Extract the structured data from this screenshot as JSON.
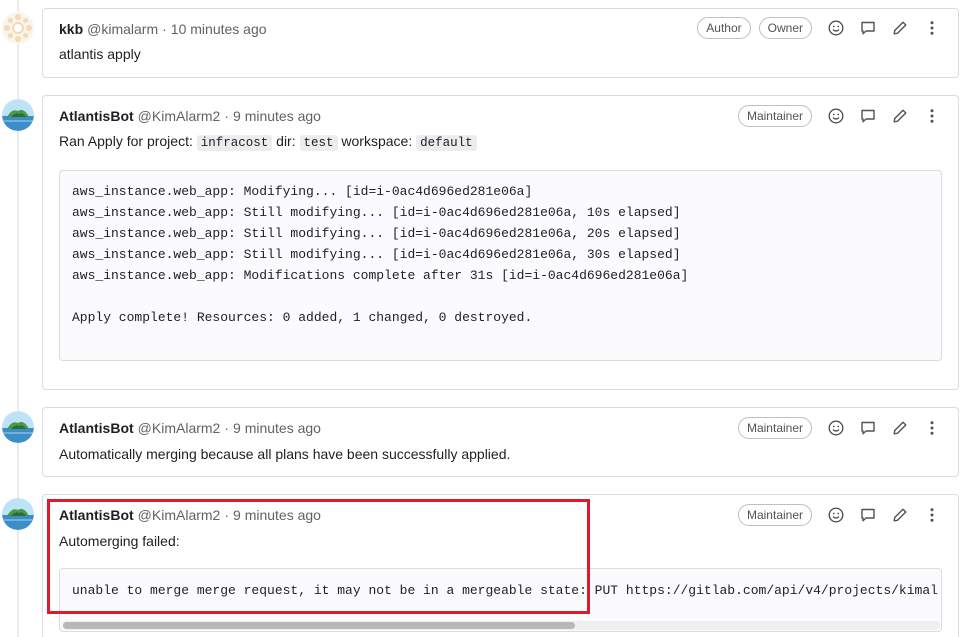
{
  "notes": [
    {
      "author": "kkb",
      "handle": "@kimalarm",
      "separator": "·",
      "time": "10 minutes ago",
      "badges": [
        "Author",
        "Owner"
      ],
      "body": "atlantis apply"
    },
    {
      "author": "AtlantisBot",
      "handle": "@KimAlarm2",
      "separator": "·",
      "time": "9 minutes ago",
      "badges": [
        "Maintainer"
      ],
      "body_parts": {
        "t1": "Ran Apply for project:",
        "c1": "infracost",
        "t2": "dir:",
        "c2": "test",
        "t3": "workspace:",
        "c3": "default"
      },
      "code_lines": [
        "aws_instance.web_app: Modifying... [id=i-0ac4d696ed281e06a]",
        "aws_instance.web_app: Still modifying... [id=i-0ac4d696ed281e06a, 10s elapsed]",
        "aws_instance.web_app: Still modifying... [id=i-0ac4d696ed281e06a, 20s elapsed]",
        "aws_instance.web_app: Still modifying... [id=i-0ac4d696ed281e06a, 30s elapsed]",
        "aws_instance.web_app: Modifications complete after 31s [id=i-0ac4d696ed281e06a]",
        "",
        "Apply complete! Resources: 0 added, 1 changed, 0 destroyed."
      ]
    },
    {
      "author": "AtlantisBot",
      "handle": "@KimAlarm2",
      "separator": "·",
      "time": "9 minutes ago",
      "badges": [
        "Maintainer"
      ],
      "body": "Automatically merging because all plans have been successfully applied."
    },
    {
      "author": "AtlantisBot",
      "handle": "@KimAlarm2",
      "separator": "·",
      "time": "9 minutes ago",
      "badges": [
        "Maintainer"
      ],
      "body": "Automerging failed:",
      "code_lines": [
        "unable to merge merge request, it may not be in a mergeable state: PUT https://gitlab.com/api/v4/projects/kimal"
      ]
    }
  ],
  "action_icons": [
    "smiley-icon",
    "comment-icon",
    "pencil-icon",
    "kebab-menu-icon"
  ],
  "colors": {
    "border": "#dcdcde",
    "badge_border": "#bfbfc3",
    "muted_text": "#626168",
    "highlight": "#e01a2b"
  }
}
